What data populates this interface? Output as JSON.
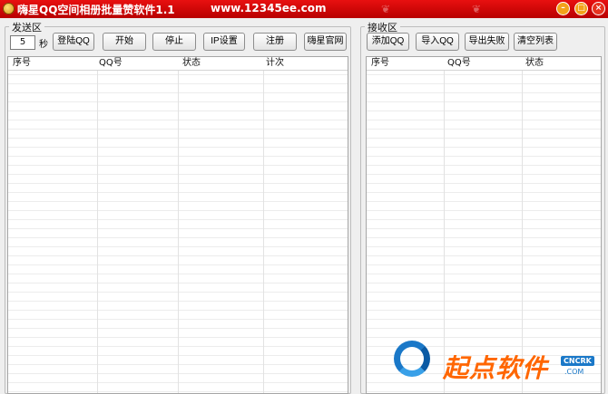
{
  "window": {
    "title": "嗨星QQ空间相册批量赞软件1.1",
    "url": "www.12345ee.com",
    "controls": {
      "minimize": "–",
      "maximize": "□",
      "close": "×"
    }
  },
  "send_panel": {
    "legend": "发送区",
    "seconds_value": "5",
    "seconds_label": "秒",
    "buttons": {
      "login": "登陆QQ",
      "start": "开始",
      "stop": "停止",
      "ip_settings": "IP设置",
      "register": "注册",
      "official_site": "嗨星官网"
    },
    "columns": [
      "序号",
      "QQ号",
      "状态",
      "计次"
    ],
    "rows": []
  },
  "receive_panel": {
    "legend": "接收区",
    "buttons": {
      "add_qq": "添加QQ",
      "import_qq": "导入QQ",
      "export_failed": "导出失败",
      "clear_list": "清空列表"
    },
    "columns": [
      "序号",
      "QQ号",
      "状态"
    ],
    "rows": []
  },
  "watermark": {
    "brand": "起点软件",
    "badge": "CNCRK",
    "domain": ".COM"
  },
  "colors": {
    "titlebar": "#d40000",
    "window_bg": "#efefef",
    "watermark_orange": "#ff6600",
    "watermark_blue": "#1a78c8"
  }
}
